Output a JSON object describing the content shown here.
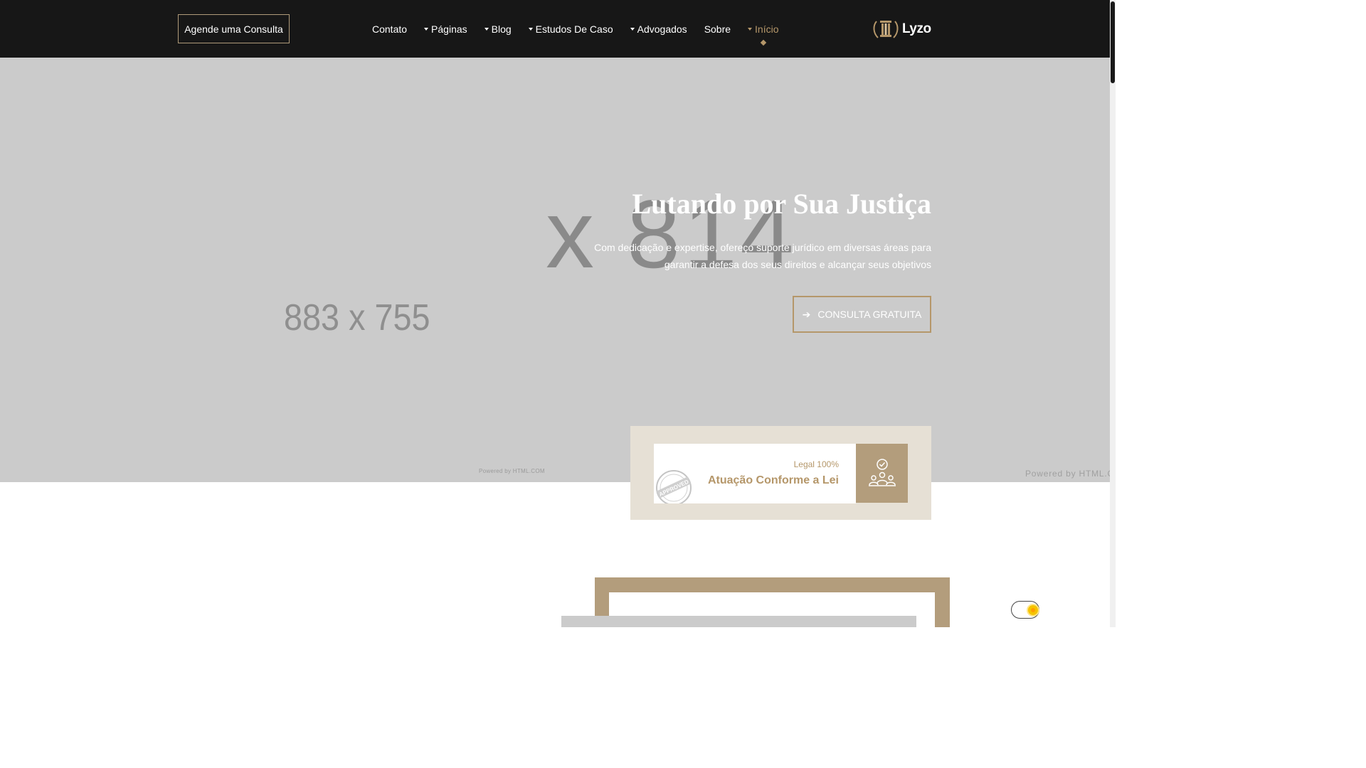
{
  "header": {
    "cta_label": "Agende uma Consulta",
    "nav": [
      {
        "label": "Contato",
        "has_dropdown": false,
        "active": false
      },
      {
        "label": "Páginas",
        "has_dropdown": true,
        "active": false
      },
      {
        "label": "Blog",
        "has_dropdown": true,
        "active": false
      },
      {
        "label": "Estudos De Caso",
        "has_dropdown": true,
        "active": false
      },
      {
        "label": "Advogados",
        "has_dropdown": true,
        "active": false
      },
      {
        "label": "Sobre",
        "has_dropdown": false,
        "active": false
      },
      {
        "label": "Início",
        "has_dropdown": true,
        "active": true
      }
    ],
    "logo_text": "Lyzo"
  },
  "hero": {
    "placeholder_large": "x 814",
    "placeholder_small": "883 x 755",
    "title": "Lutando por Sua Justiça",
    "subtitle": "Com dedicação e expertise, ofereço suporte jurídico em diversas áreas para garantir a defesa dos seus direitos e alcançar seus objetivos",
    "button_label": "CONSULTA GRATUITA",
    "powered_small": "Powered by HTML.COM",
    "powered_large": "Powered by HTML.COM"
  },
  "feature": {
    "kicker": "Legal 100%",
    "title": "Atuação Conforme a Lei",
    "stamp_text": "APPROVED",
    "icon": "team-check-icon"
  },
  "colors": {
    "header_bg": "#171717",
    "accent": "#b5976a",
    "hero_bg": "#cbcbcb",
    "feature_bg": "#e6e0d5",
    "icon_box": "#b39d7c"
  }
}
